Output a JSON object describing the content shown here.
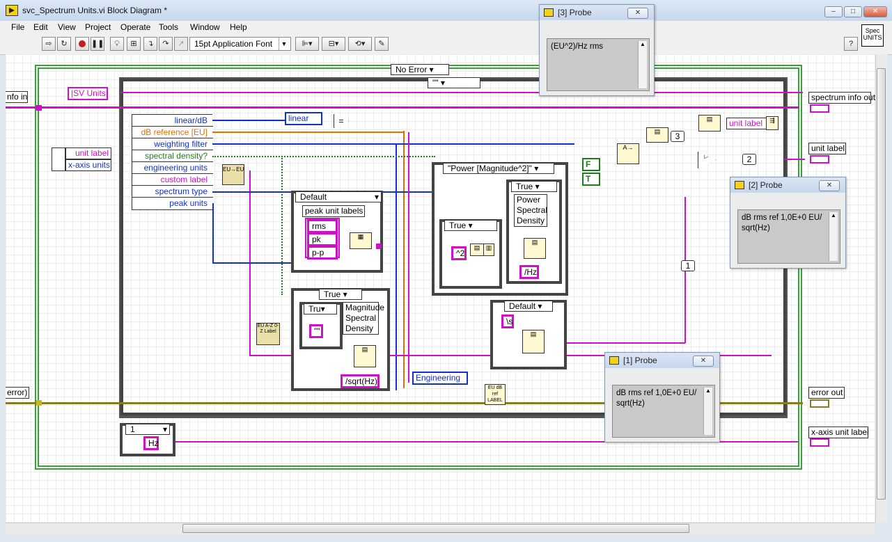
{
  "window": {
    "title": "svc_Spectrum Units.vi Block Diagram *",
    "controls": {
      "minimize": "–",
      "maximize": "□",
      "close": "✕"
    }
  },
  "menu": [
    "File",
    "Edit",
    "View",
    "Project",
    "Operate",
    "Tools",
    "Window",
    "Help"
  ],
  "toolbar": {
    "font": "15pt Application Font",
    "help": "?"
  },
  "vi_icon_label": "Spec UNITS",
  "diagram": {
    "error_case": "No Error",
    "string_case": "\"\"",
    "sv_units": "|SV Units|",
    "unbundle_top": [
      "unit label",
      "x-axis units"
    ],
    "unbundle_main": [
      {
        "label": "linear/dB",
        "color": "blue"
      },
      {
        "label": "dB reference [EU]",
        "color": "orange"
      },
      {
        "label": "weighting filter",
        "color": "blue"
      },
      {
        "label": "spectral density?",
        "color": "green"
      },
      {
        "label": "engineering units",
        "color": "blue"
      },
      {
        "label": "custom label",
        "color": "pink"
      },
      {
        "label": "spectrum type",
        "color": "blue"
      },
      {
        "label": "peak units",
        "color": "blue"
      }
    ],
    "linear_const": "linear",
    "eu_node": "EU→EU",
    "peak_case": "Default",
    "peak_unit_labels": "peak unit labels",
    "peak_items": [
      "rms",
      "pk",
      "p-p"
    ],
    "power_case": "\"Power [Magnitude^2]\"",
    "inner_true_1": "True",
    "inner_true_2": "True",
    "psd_label": "Power Spectral Density",
    "pow_const": "^2",
    "hz_const": "/Hz",
    "msd_case": "True",
    "msd_inner_case": "Tru",
    "msd_label": "Magnitude Spectral Density",
    "empty_str": "\"\"",
    "sqrt_const": "/sqrt(Hz)",
    "default_case": "Default",
    "s_const": "\\s",
    "engineering_enum": "Engineering",
    "eu_ref_node": "EU dB ref LABEL",
    "eu_label_node": "EU A-Z 0-Z Label",
    "bool_t": "T",
    "bool_f": "F",
    "tags": [
      "3",
      "2",
      "1"
    ],
    "hz_case": "1",
    "hz_str": "Hz",
    "terminals_left": {
      "info_in": "nfo in",
      "error_in": "error)"
    },
    "terminals_right": {
      "spectrum_info_out": "spectrum info out",
      "unit_label": "unit label",
      "error_out": "error out",
      "x_axis_unit_label": "x-axis unit label"
    },
    "unit_label_out": "unit label"
  },
  "probes": [
    {
      "title": "[3] Probe",
      "value": "(EU^2)/Hz rms"
    },
    {
      "title": "[2] Probe",
      "value": "dB rms ref 1,0E+0 EU/ sqrt(Hz)"
    },
    {
      "title": "[1] Probe",
      "value": "dB rms ref 1,0E+0 EU/ sqrt(Hz)"
    }
  ],
  "colors": {
    "string_wire": "#d010c8",
    "numeric_wire": "#1030d0",
    "orange_wire": "#e07000",
    "bool_wire": "#207a20",
    "error_wire": "#8a7a20",
    "case_border": "#333333",
    "loop_border": "#3aa03a"
  }
}
